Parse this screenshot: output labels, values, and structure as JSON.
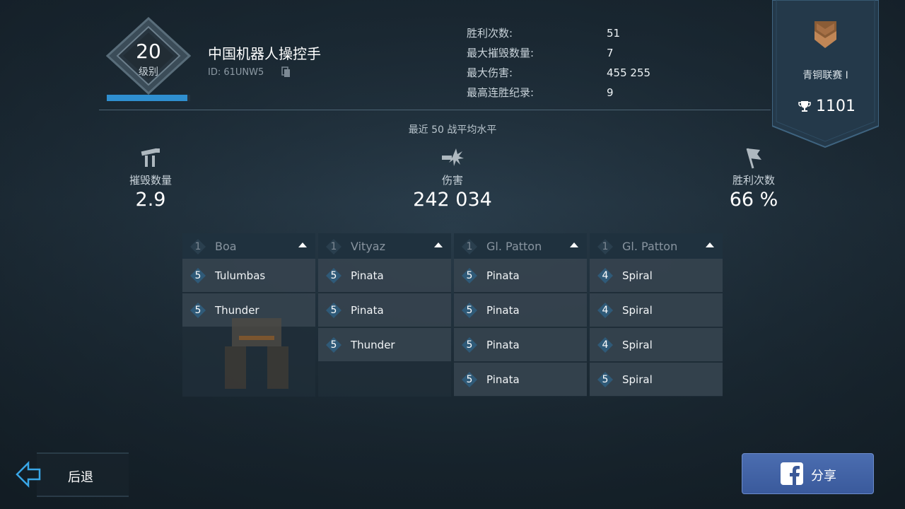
{
  "player": {
    "level": "20",
    "level_label": "级别",
    "name": "中国机器人操控手",
    "id": "ID: 61UNW5",
    "xp_progress": 0.97
  },
  "stats": [
    {
      "label": "胜利次数:",
      "value": "51"
    },
    {
      "label": "最大摧毁数量:",
      "value": "7"
    },
    {
      "label": "最大伤害:",
      "value": "455 255"
    },
    {
      "label": "最高连胜纪录:",
      "value": "9"
    }
  ],
  "league": {
    "name": "青铜联赛 I",
    "points": "1101",
    "icon": "bronze-chevron-icon"
  },
  "recent": {
    "title": "最近 50 战平均水平",
    "kills": {
      "label": "摧毁数量",
      "value": "2.9",
      "icon": "destroyed-robot-icon"
    },
    "damage": {
      "label": "伤害",
      "value": "242 034",
      "icon": "explosion-icon"
    },
    "wins": {
      "label": "胜利次数",
      "value": "66 %",
      "icon": "flag-icon"
    }
  },
  "robots": [
    {
      "level": "1",
      "name": "Boa",
      "weapons": [
        {
          "level": "5",
          "name": "Tulumbas"
        },
        {
          "level": "5",
          "name": "Thunder"
        }
      ]
    },
    {
      "level": "1",
      "name": "Vityaz",
      "weapons": [
        {
          "level": "5",
          "name": "Pinata"
        },
        {
          "level": "5",
          "name": "Pinata"
        },
        {
          "level": "5",
          "name": "Thunder"
        }
      ]
    },
    {
      "level": "1",
      "name": "Gl. Patton",
      "weapons": [
        {
          "level": "5",
          "name": "Pinata"
        },
        {
          "level": "5",
          "name": "Pinata"
        },
        {
          "level": "5",
          "name": "Pinata"
        },
        {
          "level": "5",
          "name": "Pinata"
        }
      ]
    },
    {
      "level": "1",
      "name": "Gl. Patton",
      "weapons": [
        {
          "level": "4",
          "name": "Spiral"
        },
        {
          "level": "4",
          "name": "Spiral"
        },
        {
          "level": "4",
          "name": "Spiral"
        },
        {
          "level": "5",
          "name": "Spiral"
        }
      ]
    }
  ],
  "buttons": {
    "back": "后退",
    "share": "分享"
  },
  "colors": {
    "accent": "#2f8fd0",
    "share": "#3a5a9c",
    "bronze": "#b07a4c"
  }
}
